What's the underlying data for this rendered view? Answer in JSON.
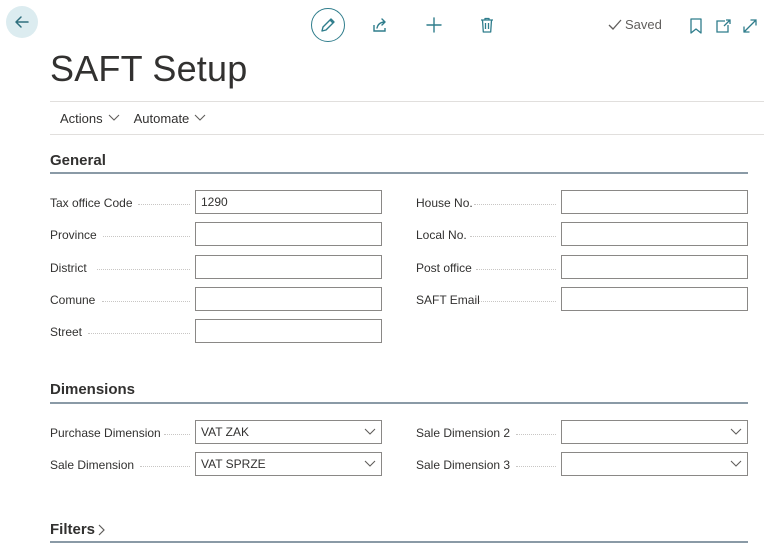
{
  "header": {
    "saved_label": "Saved",
    "title": "SAFT Setup"
  },
  "action_bar": {
    "actions_label": "Actions",
    "automate_label": "Automate"
  },
  "general": {
    "title": "General",
    "tax_office_code": {
      "label": "Tax office Code",
      "value": "1290"
    },
    "province": {
      "label": "Province",
      "value": ""
    },
    "district": {
      "label": "District",
      "value": ""
    },
    "comune": {
      "label": "Comune",
      "value": ""
    },
    "street": {
      "label": "Street",
      "value": ""
    },
    "house_no": {
      "label": "House No.",
      "value": ""
    },
    "local_no": {
      "label": "Local No.",
      "value": ""
    },
    "post_office": {
      "label": "Post office",
      "value": ""
    },
    "saft_email": {
      "label": "SAFT Email",
      "value": ""
    }
  },
  "dimensions": {
    "title": "Dimensions",
    "purchase_dimension": {
      "label": "Purchase Dimension",
      "value": "VAT ZAK"
    },
    "sale_dimension": {
      "label": "Sale Dimension",
      "value": "VAT SPRZE"
    },
    "sale_dimension_2": {
      "label": "Sale Dimension 2",
      "value": ""
    },
    "sale_dimension_3": {
      "label": "Sale Dimension 3",
      "value": ""
    }
  },
  "filters": {
    "title": "Filters"
  }
}
